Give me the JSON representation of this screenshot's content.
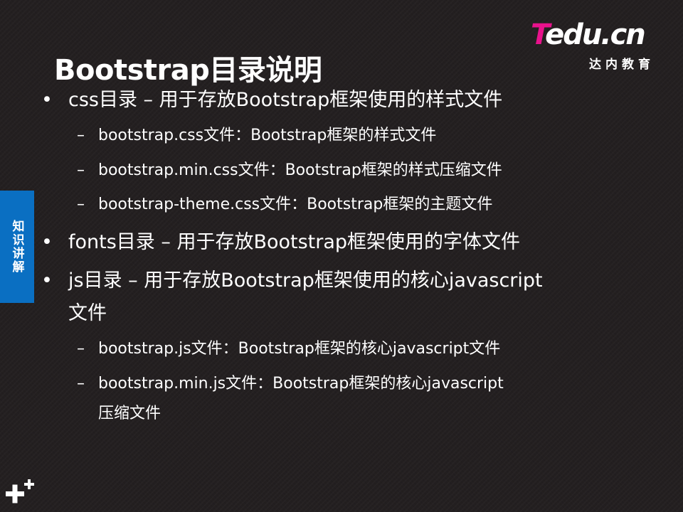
{
  "slide": {
    "title": "Bootstrap目录说明",
    "side_tab": "知识讲解",
    "logo": {
      "part1": "T",
      "part2": "edu.cn",
      "sub": "达内教育"
    },
    "bullet_symbol": "•",
    "dash_symbol": "–",
    "items": [
      {
        "level": 1,
        "text": "css目录 – 用于存放Bootstrap框架使用的样式文件"
      },
      {
        "level": 2,
        "text": "bootstrap.css文件：Bootstrap框架的样式文件"
      },
      {
        "level": 2,
        "text": "bootstrap.min.css文件：Bootstrap框架的样式压缩文件"
      },
      {
        "level": 2,
        "text": "bootstrap-theme.css文件：Bootstrap框架的主题文件"
      },
      {
        "level": 1,
        "text": "fonts目录 – 用于存放Bootstrap框架使用的字体文件"
      },
      {
        "level": 1,
        "text": "js目录 – 用于存放Bootstrap框架使用的核心javascript"
      },
      {
        "level": 1,
        "text": "文件",
        "continuation": true
      },
      {
        "level": 2,
        "text": "bootstrap.js文件：Bootstrap框架的核心javascript文件"
      },
      {
        "level": 2,
        "text": "bootstrap.min.js文件：Bootstrap框架的核心javascript"
      },
      {
        "level": 2,
        "text": "压缩文件",
        "continuation": true
      }
    ],
    "colors": {
      "background": "#231f20",
      "text": "#ffffff",
      "tab_blue": "#0a6fc2",
      "logo_pink": "#e8128c"
    },
    "icons": {
      "corner": "plus-decoration-icon"
    }
  }
}
